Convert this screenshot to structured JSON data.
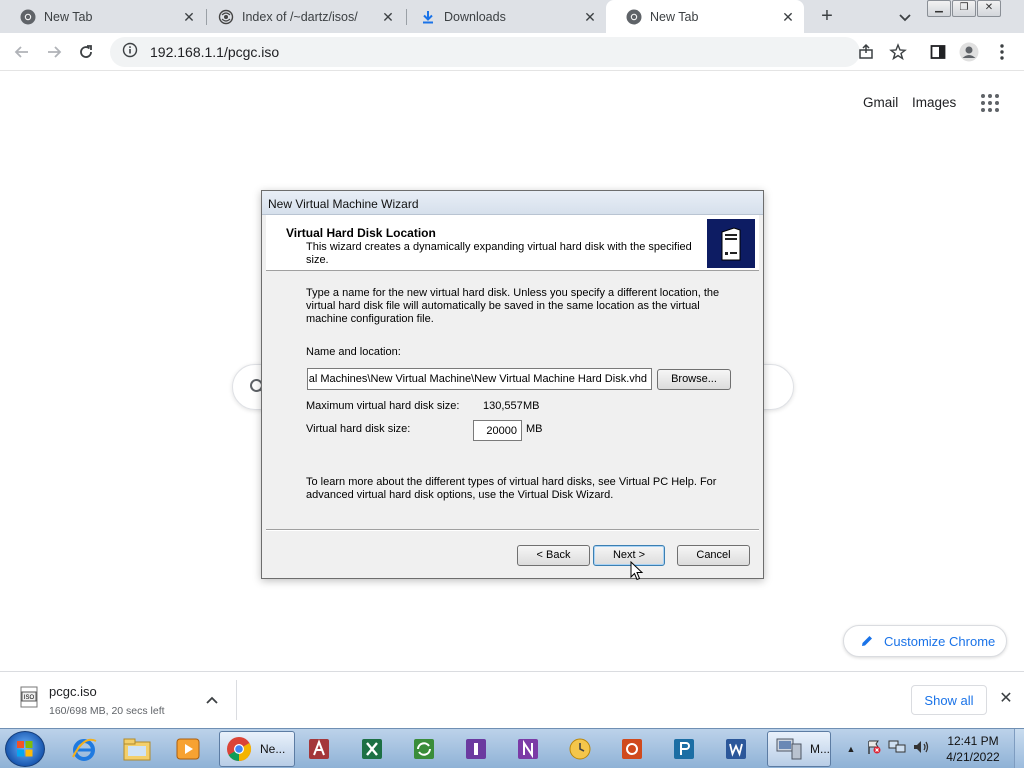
{
  "browser": {
    "tabs": [
      {
        "title": "New Tab",
        "icon": "chrome-icon"
      },
      {
        "title": "Index of /~dartz/isos/",
        "icon": "site-icon"
      },
      {
        "title": "Downloads",
        "icon": "download-icon"
      },
      {
        "title": "New Tab",
        "icon": "chrome-icon",
        "active": true
      }
    ],
    "new_tab": "+",
    "url": "192.168.1.1/pcgc.iso"
  },
  "newtab_page": {
    "gmail": "Gmail",
    "images": "Images",
    "customize": "Customize Chrome"
  },
  "dialog": {
    "title": "New Virtual Machine Wizard",
    "heading": "Virtual Hard Disk Location",
    "subheading": "This wizard creates a dynamically expanding virtual hard disk with the specified size.",
    "intro": "Type a name for the new virtual hard disk. Unless you specify a different location, the virtual hard disk file will automatically be saved in the same location as the virtual machine configuration file.",
    "name_label": "Name and location:",
    "name_value": "ual Machines\\New Virtual Machine\\New Virtual Machine Hard Disk.vhd",
    "browse": "Browse...",
    "max_label": "Maximum virtual hard disk size:",
    "max_value": "130,557",
    "max_unit": "MB",
    "size_label": "Virtual hard disk size:",
    "size_value": "20000",
    "size_unit": "MB",
    "help": "To learn more about the different types of virtual hard disks, see Virtual PC Help. For advanced virtual hard disk options, use the Virtual Disk Wizard.",
    "back": "< Back",
    "next": "Next >",
    "cancel": "Cancel"
  },
  "download_bar": {
    "filename": "pcgc.iso",
    "status": "160/698 MB, 20 secs left",
    "show_all": "Show all"
  },
  "taskbar": {
    "chrome_label": "Ne...",
    "vpc_label": "M...",
    "time": "12:41 PM",
    "date": "4/21/2022"
  },
  "colors": {
    "tab_strip": "#dee1e6",
    "chrome_blue": "#1a73e8",
    "wizard_icon_bg": "#0d1c63",
    "dialog_bg": "#f0f0f0"
  }
}
